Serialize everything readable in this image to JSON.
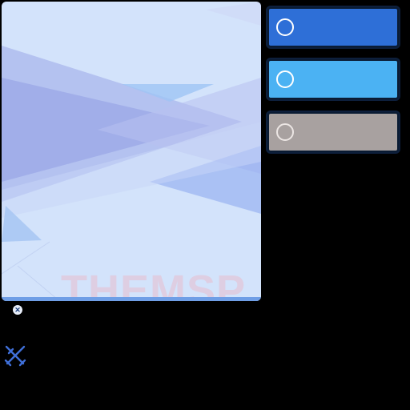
{
  "preview": {
    "watermark": "THEMSP"
  },
  "swatches": [
    {
      "color": "#2e6fd7",
      "selected": false,
      "ring": "#ffffff"
    },
    {
      "color": "#4bb2f3",
      "selected": false,
      "ring": "#ffffff"
    },
    {
      "color": "#a8a1a0",
      "selected": false,
      "ring": "#ece6e4"
    }
  ],
  "icons": {
    "close": "close-icon",
    "tool": "crossed-swords-icon"
  },
  "colors": {
    "preview_bg": "#d3e3fb",
    "accent": "#6f9ee6"
  }
}
